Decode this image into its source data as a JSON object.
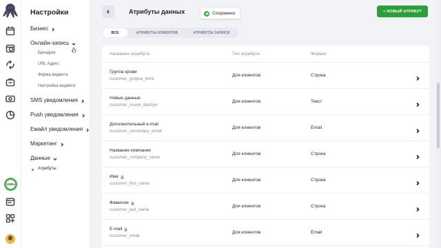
{
  "rail": {
    "logo": "octopus-logo",
    "icons": [
      "calendar-icon",
      "money-clock-icon",
      "cycle-icon",
      "briefcase-icon",
      "cash-icon",
      "chart-pie-icon",
      "window-icon",
      "apps-grid-icon"
    ],
    "progress_label": "100%"
  },
  "sidebar": {
    "title": "Настройки",
    "items": [
      {
        "label": "Бизнес"
      },
      {
        "label": "Онлайн-запись",
        "sub": [
          "Брендинг",
          "URL Адрес",
          "Форма виджета",
          "Настройка виджета"
        ]
      },
      {
        "label": "SMS уведомления"
      },
      {
        "label": "Push уведомления"
      },
      {
        "label": "Емайл уведомления"
      },
      {
        "label": "Маркетинг"
      },
      {
        "label": "Данные",
        "sub": [
          "Атрибуты"
        ]
      }
    ]
  },
  "header": {
    "title": "Атрибуты данных",
    "toast": "Сохранено",
    "new_button": "+ НОВЫЙ АТРИБУТ"
  },
  "tabs": [
    "ВСЕ",
    "АТРИБУТЫ КЛИЕНТОВ",
    "АТРИБУТЫ ЗАПИСИ"
  ],
  "table": {
    "columns": [
      "Название атрибута",
      "Тип атрибута",
      "Формат"
    ],
    "rows": [
      {
        "name": "Группа крови",
        "code": "customer_gruppa_krovi",
        "type": "Для клиентов",
        "format": "Строка",
        "locked": false
      },
      {
        "name": "Новые данные",
        "code": "customer_novye_dannye",
        "type": "Для клиентов",
        "format": "Текст",
        "locked": false
      },
      {
        "name": "Дополнительный e-mail",
        "code": "customer_secondary_email",
        "type": "Для клиентов",
        "format": "Email",
        "locked": false
      },
      {
        "name": "Название компании",
        "code": "customer_company_name",
        "type": "Для клиентов",
        "format": "Строка",
        "locked": false
      },
      {
        "name": "Имя",
        "code": "customer_first_name",
        "type": "Для клиентов",
        "format": "Строка",
        "locked": true
      },
      {
        "name": "Фамилия",
        "code": "customer_last_name",
        "type": "Для клиентов",
        "format": "Строка",
        "locked": true
      },
      {
        "name": "E-mail",
        "code": "customer_email",
        "type": "Для клиентов",
        "format": "Email",
        "locked": true
      }
    ]
  },
  "colors": {
    "accent": "#2e9e3c",
    "background": "#f2f3f7",
    "toast_check": "#3fae49"
  }
}
